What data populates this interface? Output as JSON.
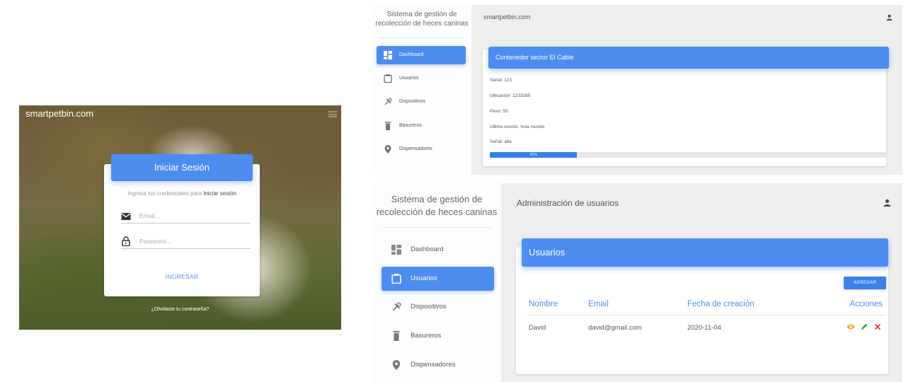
{
  "login": {
    "brand": "smartpetbin.com",
    "title": "Iniciar Sesión",
    "description_prefix": "Ingresa tus credenciales para ",
    "description_bold": "Iniciar sesión",
    "email_placeholder": "Email...",
    "password_placeholder": "Password...",
    "submit_label": "INGRESAR",
    "forgot_label": "¿Olvidaste tu contraseña?"
  },
  "sidebar": {
    "title_line1": "Sistema de gestión de",
    "title_line2": "recolección de heces caninas",
    "items": [
      {
        "label": "Dashboard",
        "icon": "dashboard-icon"
      },
      {
        "label": "Usuarios",
        "icon": "clipboard-icon"
      },
      {
        "label": "Dispositivos",
        "icon": "tools-icon"
      },
      {
        "label": "Basureros",
        "icon": "trash-icon"
      },
      {
        "label": "Dispensadores",
        "icon": "location-pin-icon"
      }
    ]
  },
  "dashboard": {
    "topbar_title": "smartpetbin.com",
    "active_item": "Dashboard",
    "card_title": "Contenedor sector El Cable",
    "serial": "Serial: 123",
    "location": "Ubicación: 1233265",
    "weight": "Peso: 55",
    "last_event": "Ultimo evento: hola mundo",
    "signal": "Señal: alta",
    "progress_percent": 22,
    "progress_label": "22%",
    "progress_color": "#2f82e8"
  },
  "users": {
    "topbar_title": "Administración de usuarios",
    "active_item": "Usuarios",
    "card_title": "Usuarios",
    "add_label": "AGREGAR",
    "columns": [
      "Nombre",
      "Email",
      "Fecha de creación",
      "Acciones"
    ],
    "rows": [
      {
        "name": "David",
        "email": "david@gmail.com",
        "created": "2020-11-04",
        "actions": [
          "view-eye-icon",
          "edit-pencil-icon",
          "delete-x-icon"
        ]
      }
    ]
  },
  "colors": {
    "primary": "#4d8df0",
    "view": "#f5a623",
    "edit": "#3aa03a",
    "delete": "#e53935"
  }
}
